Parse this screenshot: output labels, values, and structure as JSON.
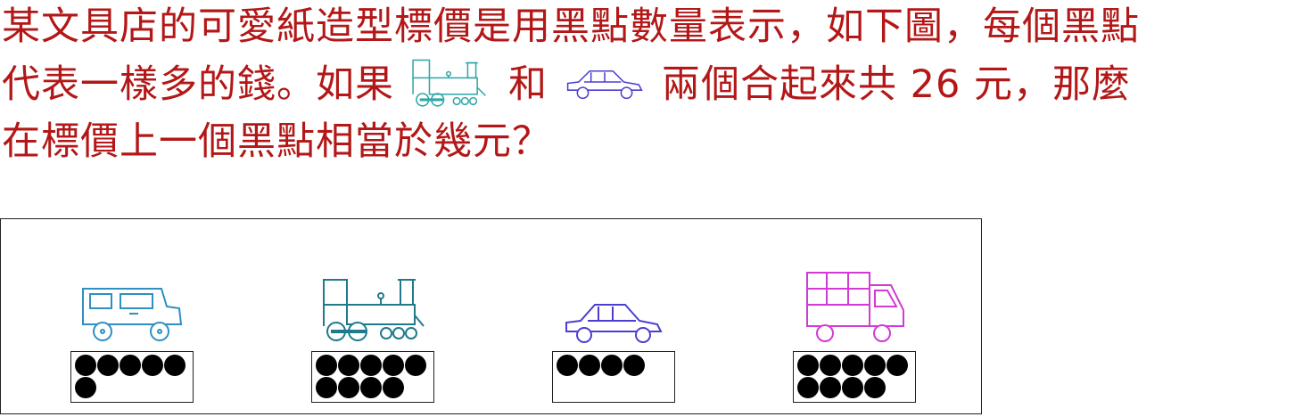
{
  "question": {
    "line1": "某文具店的可愛紙造型標價是用黑點數量表示，如下圖，每個黑點",
    "line2_a": "代表一樣多的錢。如果",
    "line2_b": "和",
    "line2_c": "兩個合起來共 26 元，那麼",
    "line3": "在標價上一個黑點相當於幾元？"
  },
  "colors": {
    "text": "#b31717",
    "jeep": "#2f8fc1",
    "train": "#1f7a8c",
    "car": "#4a3fd1",
    "truck": "#d23ad6"
  },
  "items": [
    {
      "name": "jeep",
      "icon": "jeep-icon",
      "dots": 6
    },
    {
      "name": "train",
      "icon": "train-icon",
      "dots": 9
    },
    {
      "name": "car",
      "icon": "car-icon",
      "dots": 4
    },
    {
      "name": "truck",
      "icon": "truck-icon",
      "dots": 9
    }
  ]
}
